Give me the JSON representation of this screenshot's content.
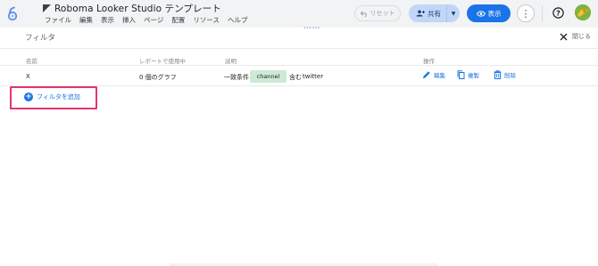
{
  "header": {
    "title": "Roboma Looker Studio テンプレート",
    "menu": [
      "ファイル",
      "編集",
      "表示",
      "挿入",
      "ページ",
      "配置",
      "リソース",
      "ヘルプ"
    ],
    "reset_label": "リセット",
    "share_label": "共有",
    "view_label": "表示",
    "more_glyph": "⋮",
    "help_glyph": "?"
  },
  "panel": {
    "title": "フィルタ",
    "close_label": "閉じる",
    "drag_handle": "⋯⋯"
  },
  "table": {
    "columns": [
      "名前",
      "レポートで使用中",
      "説明",
      "操作"
    ],
    "rows": [
      {
        "name": "X",
        "usage": "0 個のグラフ",
        "condition_prefix": "一致条件",
        "field": "channel",
        "operator": "含む",
        "value": "twitter"
      }
    ],
    "actions": [
      "編集",
      "複製",
      "削除"
    ]
  },
  "add_filter_label": "フィルタを追加",
  "colors": {
    "accent": "#1a73e8",
    "highlight_border": "#e8336d",
    "chip": "#ceead6",
    "share_bg": "#c2d7f7"
  }
}
